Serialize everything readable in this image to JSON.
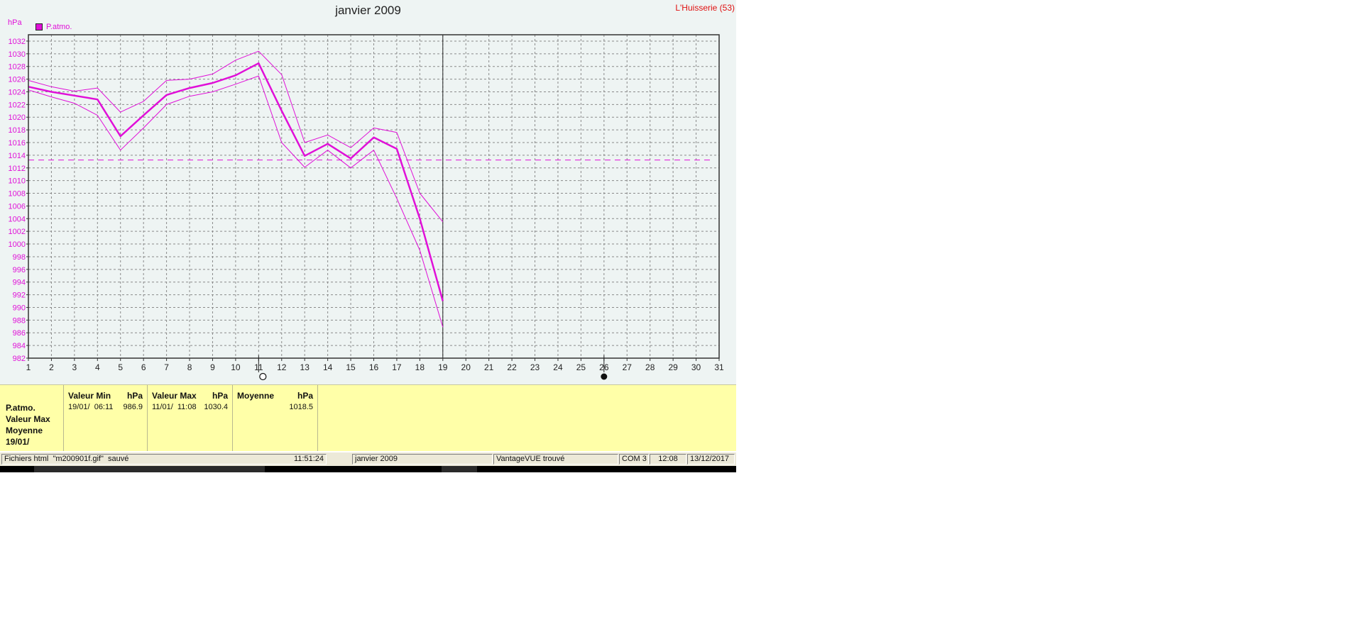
{
  "title": "janvier 2009",
  "station": "L'Huisserie (53)",
  "unit": "hPa",
  "legend": {
    "label": "P.atmo.",
    "color": "#e010d8"
  },
  "chart_data": {
    "type": "line",
    "title": "janvier 2009",
    "xlabel": "",
    "ylabel": "hPa",
    "x_ticks": [
      1,
      2,
      3,
      4,
      5,
      6,
      7,
      8,
      9,
      10,
      11,
      12,
      13,
      14,
      15,
      16,
      17,
      18,
      19,
      20,
      21,
      22,
      23,
      24,
      25,
      26,
      27,
      28,
      29,
      30,
      31
    ],
    "y_ticks": [
      982,
      984,
      986,
      988,
      990,
      992,
      994,
      996,
      998,
      1000,
      1002,
      1004,
      1006,
      1008,
      1010,
      1012,
      1014,
      1016,
      1018,
      1020,
      1022,
      1024,
      1026,
      1028,
      1030,
      1032
    ],
    "xlim": [
      1,
      31
    ],
    "ylim": [
      982,
      1033
    ],
    "grid": true,
    "legend_position": "top-left",
    "series": [
      {
        "name": "P.atmo.",
        "role": "moyenne",
        "color": "#e010d8",
        "x": [
          1,
          2,
          3,
          4,
          5,
          6,
          7,
          8,
          9,
          10,
          11,
          12,
          13,
          14,
          15,
          16,
          17,
          18,
          19
        ],
        "values": [
          1024.8,
          1024.0,
          1023.4,
          1022.8,
          1017.0,
          1020.3,
          1023.5,
          1024.6,
          1025.4,
          1026.6,
          1028.5,
          1021.0,
          1013.9,
          1015.8,
          1013.5,
          1016.8,
          1015.0,
          1004.0,
          991.0
        ]
      },
      {
        "name": "",
        "role": "max",
        "color": "#e010d8",
        "x": [
          1,
          2,
          3,
          4,
          5,
          6,
          7,
          8,
          9,
          10,
          11,
          12,
          13,
          14,
          15,
          16,
          17,
          18,
          19
        ],
        "values": [
          1025.8,
          1024.8,
          1024.1,
          1024.6,
          1020.8,
          1022.5,
          1025.8,
          1026.0,
          1026.8,
          1029.0,
          1030.4,
          1026.7,
          1016.0,
          1017.2,
          1015.2,
          1018.3,
          1017.6,
          1008.0,
          1003.5
        ]
      },
      {
        "name": "",
        "role": "min",
        "color": "#e010d8",
        "x": [
          1,
          2,
          3,
          4,
          5,
          6,
          7,
          8,
          9,
          10,
          11,
          12,
          13,
          14,
          15,
          16,
          17,
          18,
          19
        ],
        "values": [
          1024.3,
          1023.2,
          1022.2,
          1020.3,
          1014.8,
          1018.3,
          1022.0,
          1023.3,
          1024.0,
          1025.2,
          1026.5,
          1016.0,
          1012.1,
          1014.8,
          1012.0,
          1014.8,
          1007.2,
          999.0,
          986.9
        ]
      }
    ],
    "average_line": 1013.25,
    "cursor_x": 19,
    "moon_phases": [
      {
        "x": 11,
        "phase": "full-moon"
      },
      {
        "x": 26,
        "phase": "new-moon"
      }
    ]
  },
  "stats": {
    "labels": [
      "P.atmo.",
      "Valeur Max",
      "Moyenne",
      "19/01/"
    ],
    "min": {
      "title": "Valeur Min",
      "unit": "hPa",
      "date": "19/01/  06:11",
      "value": "986.9"
    },
    "max": {
      "title": "Valeur Max",
      "unit": "hPa",
      "date": "11/01/  11:08",
      "value": "1030.4"
    },
    "avg": {
      "title": "Moyenne",
      "unit": "hPa",
      "value": "1018.5"
    }
  },
  "status": {
    "message": "Fichiers html  \"m200901f.gif\"  sauvé",
    "time": "11:51:24",
    "period": "janvier 2009",
    "device": "VantageVUE trouvé",
    "port": "COM 3",
    "clock": "12:08",
    "date": "13/12/2017"
  }
}
